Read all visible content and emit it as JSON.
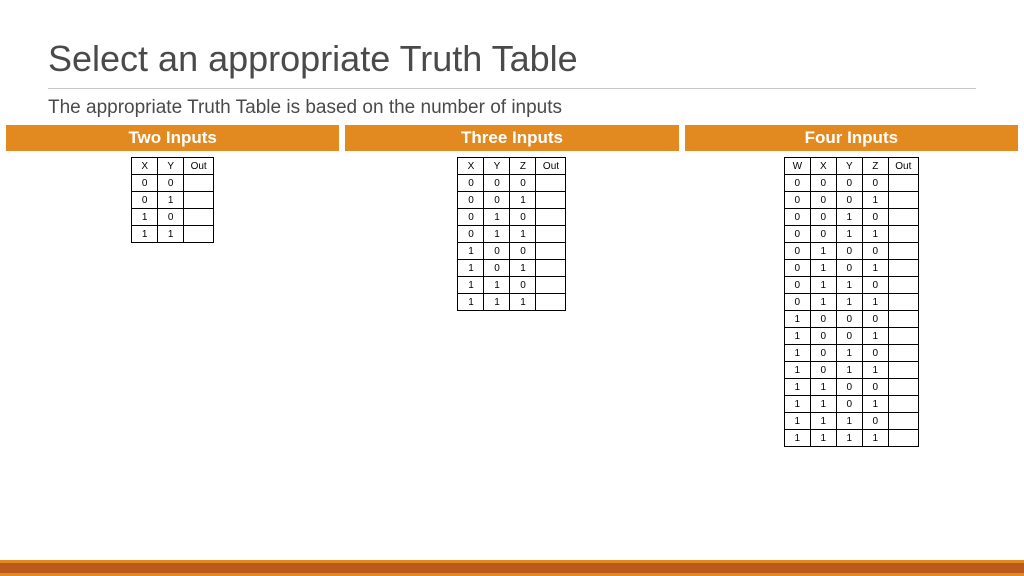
{
  "title": "Select an appropriate Truth Table",
  "subtitle": "The appropriate Truth Table is based on the number of inputs",
  "sections": {
    "two": {
      "header": "Two Inputs"
    },
    "three": {
      "header": "Three Inputs"
    },
    "four": {
      "header": "Four Inputs"
    }
  },
  "chart_data": [
    {
      "type": "table",
      "title": "Two Inputs",
      "headers": [
        "X",
        "Y",
        "Out"
      ],
      "rows": [
        [
          "0",
          "0",
          ""
        ],
        [
          "0",
          "1",
          ""
        ],
        [
          "1",
          "0",
          ""
        ],
        [
          "1",
          "1",
          ""
        ]
      ]
    },
    {
      "type": "table",
      "title": "Three Inputs",
      "headers": [
        "X",
        "Y",
        "Z",
        "Out"
      ],
      "rows": [
        [
          "0",
          "0",
          "0",
          ""
        ],
        [
          "0",
          "0",
          "1",
          ""
        ],
        [
          "0",
          "1",
          "0",
          ""
        ],
        [
          "0",
          "1",
          "1",
          ""
        ],
        [
          "1",
          "0",
          "0",
          ""
        ],
        [
          "1",
          "0",
          "1",
          ""
        ],
        [
          "1",
          "1",
          "0",
          ""
        ],
        [
          "1",
          "1",
          "1",
          ""
        ]
      ]
    },
    {
      "type": "table",
      "title": "Four Inputs",
      "headers": [
        "W",
        "X",
        "Y",
        "Z",
        "Out"
      ],
      "rows": [
        [
          "0",
          "0",
          "0",
          "0",
          ""
        ],
        [
          "0",
          "0",
          "0",
          "1",
          ""
        ],
        [
          "0",
          "0",
          "1",
          "0",
          ""
        ],
        [
          "0",
          "0",
          "1",
          "1",
          ""
        ],
        [
          "0",
          "1",
          "0",
          "0",
          ""
        ],
        [
          "0",
          "1",
          "0",
          "1",
          ""
        ],
        [
          "0",
          "1",
          "1",
          "0",
          ""
        ],
        [
          "0",
          "1",
          "1",
          "1",
          ""
        ],
        [
          "1",
          "0",
          "0",
          "0",
          ""
        ],
        [
          "1",
          "0",
          "0",
          "1",
          ""
        ],
        [
          "1",
          "0",
          "1",
          "0",
          ""
        ],
        [
          "1",
          "0",
          "1",
          "1",
          ""
        ],
        [
          "1",
          "1",
          "0",
          "0",
          ""
        ],
        [
          "1",
          "1",
          "0",
          "1",
          ""
        ],
        [
          "1",
          "1",
          "1",
          "0",
          ""
        ],
        [
          "1",
          "1",
          "1",
          "1",
          ""
        ]
      ]
    }
  ]
}
